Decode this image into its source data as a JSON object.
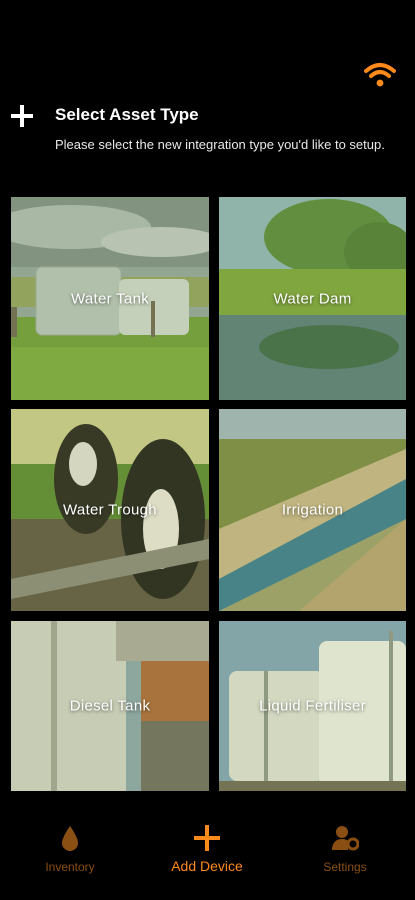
{
  "header": {
    "title": "Select Asset Type",
    "subtitle": "Please select the new integration type you'd like to setup."
  },
  "assets": [
    {
      "label": "Water Tank"
    },
    {
      "label": "Water Dam"
    },
    {
      "label": "Water Trough"
    },
    {
      "label": "Irrigation"
    },
    {
      "label": "Diesel Tank"
    },
    {
      "label": "Liquid Fertiliser"
    }
  ],
  "nav": {
    "inventory": "Inventory",
    "add_device": "Add Device",
    "settings": "Settings"
  },
  "colors": {
    "accent": "#ff8a1c",
    "muted_nav": "#8a4f12",
    "background": "#000000"
  },
  "icons": [
    "wifi-icon",
    "add-icon",
    "drop-icon",
    "plus-icon",
    "user-gear-icon"
  ]
}
